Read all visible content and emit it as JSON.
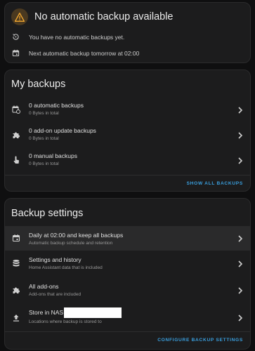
{
  "status": {
    "title": "No automatic backup available",
    "line1": "You have no automatic backups yet.",
    "line2": "Next automatic backup tomorrow at 02:00",
    "icons": {
      "title": "warning-icon",
      "line1": "backup-restore-icon",
      "line2": "calendar-icon"
    }
  },
  "my_backups": {
    "title": "My backups",
    "items": [
      {
        "title": "0 automatic backups",
        "subtitle": "0 Bytes in total",
        "icon": "calendar-sync-icon"
      },
      {
        "title": "0 add-on update backups",
        "subtitle": "0 Bytes in total",
        "icon": "puzzle-icon"
      },
      {
        "title": "0 manual backups",
        "subtitle": "0 Bytes in total",
        "icon": "gesture-tap-icon"
      }
    ],
    "action": "Show all backups"
  },
  "backup_settings": {
    "title": "Backup settings",
    "items": [
      {
        "title": "Daily at 02:00 and keep all backups",
        "subtitle": "Automatic backup schedule and retention",
        "icon": "calendar-icon"
      },
      {
        "title": "Settings and history",
        "subtitle": "Home Assistant data that is included",
        "icon": "database-icon"
      },
      {
        "title": "All add-ons",
        "subtitle": "Add-ons that are included",
        "icon": "puzzle-icon"
      },
      {
        "title": "Store in NAS",
        "subtitle": "Locations where backup is stored to",
        "icon": "upload-icon"
      }
    ],
    "action": "Configure backup settings"
  },
  "colors": {
    "background": "#0f0f10",
    "card": "#1c1c1d",
    "accent": "#3a9fde",
    "warning": "#f0a630"
  }
}
